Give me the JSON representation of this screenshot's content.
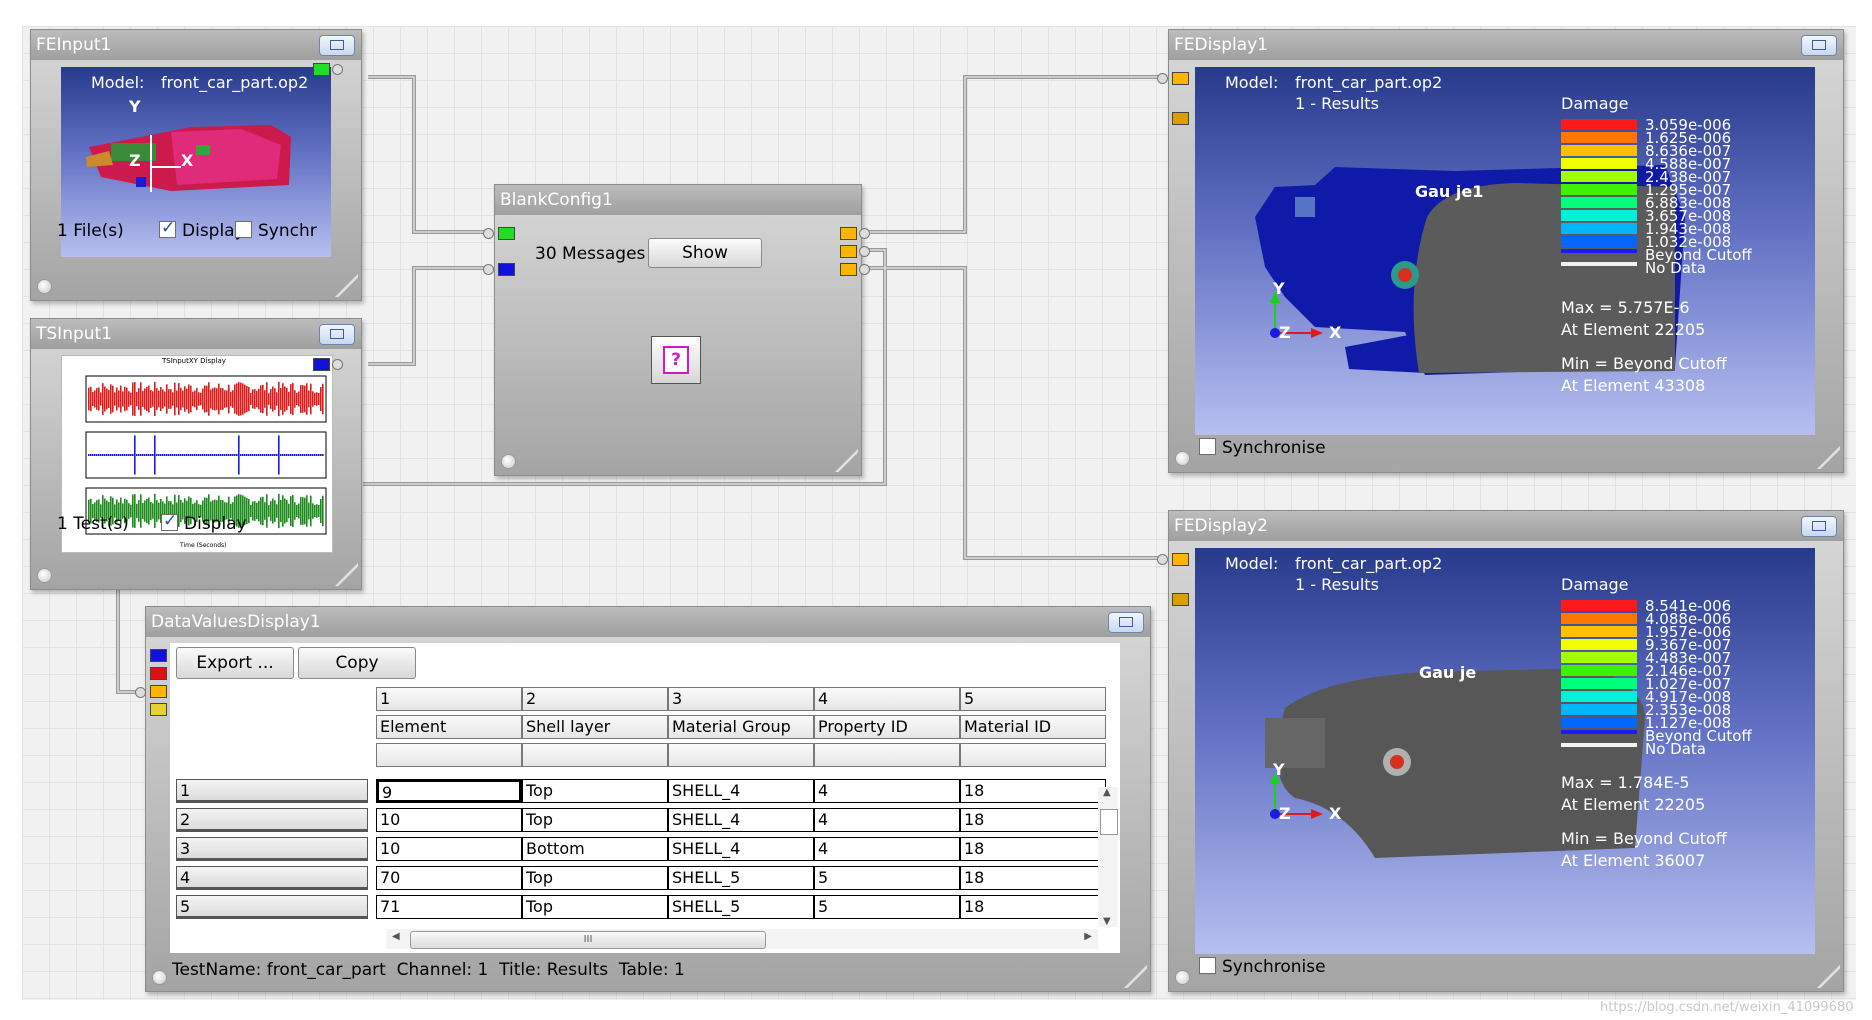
{
  "fe_input": {
    "title": "FEInput1",
    "model_label": "Model:",
    "model_value": "front_car_part.op2",
    "files_text": "1 File(s)",
    "display_label": "Display",
    "sync_label": "Synchr",
    "axis_y": "Y",
    "axis_x": "X",
    "axis_z": "Z"
  },
  "ts_input": {
    "title": "TSInput1",
    "plot_title": "TSInputXY Display",
    "plot_xlabel": "Time (Seconds)",
    "tests_text": "1 Test(s)",
    "display_label": "Display"
  },
  "blank_config": {
    "title": "BlankConfig1",
    "messages_text": "30 Messages",
    "show_label": "Show",
    "help_glyph": "?"
  },
  "fe_display1": {
    "title": "FEDisplay1",
    "model_label": "Model:",
    "model_value": "front_car_part.op2",
    "results_text": "1 - Results",
    "legend_title": "Damage",
    "gauge_label": "Gau je1",
    "legend_values": [
      "3.059e-006",
      "1.625e-006",
      "8.636e-007",
      "4.588e-007",
      "2.438e-007",
      "1.295e-007",
      "6.883e-008",
      "3.657e-008",
      "1.943e-008",
      "1.032e-008",
      "Beyond Cutoff",
      "No Data"
    ],
    "legend_colors": [
      "#ff1a1a",
      "#ff7700",
      "#ffc000",
      "#f0ff00",
      "#a4ff00",
      "#3ff000",
      "#00ff7a",
      "#00f0d8",
      "#00b7ff",
      "#0066ff",
      "#1a1aff",
      "#f2f2f2"
    ],
    "max_text": "Max = 5.757E-6",
    "max_elem": "At Element 22205",
    "min_text": "Min = Beyond Cutoff",
    "min_elem": "At Element 43308",
    "axis_y": "Y",
    "axis_x": "X",
    "axis_z": "Z",
    "sync_label": "Synchronise"
  },
  "fe_display2": {
    "title": "FEDisplay2",
    "model_label": "Model:",
    "model_value": "front_car_part.op2",
    "results_text": "1 - Results",
    "legend_title": "Damage",
    "gauge_label": "Gau je",
    "legend_values": [
      "8.541e-006",
      "4.088e-006",
      "1.957e-006",
      "9.367e-007",
      "4.483e-007",
      "2.146e-007",
      "1.027e-007",
      "4.917e-008",
      "2.353e-008",
      "1.127e-008",
      "Beyond Cutoff",
      "No Data"
    ],
    "legend_colors": [
      "#ff1a1a",
      "#ff7700",
      "#ffc000",
      "#f0ff00",
      "#a4ff00",
      "#3ff000",
      "#00ff7a",
      "#00f0d8",
      "#00b7ff",
      "#0066ff",
      "#1a1aff",
      "#f2f2f2"
    ],
    "max_text": "Max = 1.784E-5",
    "max_elem": "At Element 22205",
    "min_text": "Min = Beyond Cutoff",
    "min_elem": "At Element 36007",
    "axis_y": "Y",
    "axis_x": "X",
    "axis_z": "Z",
    "sync_label": "Synchronise"
  },
  "data_values": {
    "title": "DataValuesDisplay1",
    "export_label": "Export ...",
    "copy_label": "Copy",
    "col_numbers": [
      "1",
      "2",
      "3",
      "4",
      "5"
    ],
    "col_names": [
      "Element",
      "Shell layer",
      "Material Group",
      "Property ID",
      "Material ID"
    ],
    "row_headers": [
      "1",
      "2",
      "3",
      "4",
      "5"
    ],
    "rows": [
      [
        "9",
        "Top",
        "SHELL_4",
        "4",
        "18"
      ],
      [
        "10",
        "Top",
        "SHELL_4",
        "4",
        "18"
      ],
      [
        "10",
        "Bottom",
        "SHELL_4",
        "4",
        "18"
      ],
      [
        "70",
        "Top",
        "SHELL_5",
        "5",
        "18"
      ],
      [
        "71",
        "Top",
        "SHELL_5",
        "5",
        "18"
      ]
    ],
    "status": "TestName: front_car_part  Channel: 1  Title: Results  Table: 1",
    "scroll_glyph": "III"
  },
  "watermark": "https://blog.csdn.net/weixin_41099680"
}
